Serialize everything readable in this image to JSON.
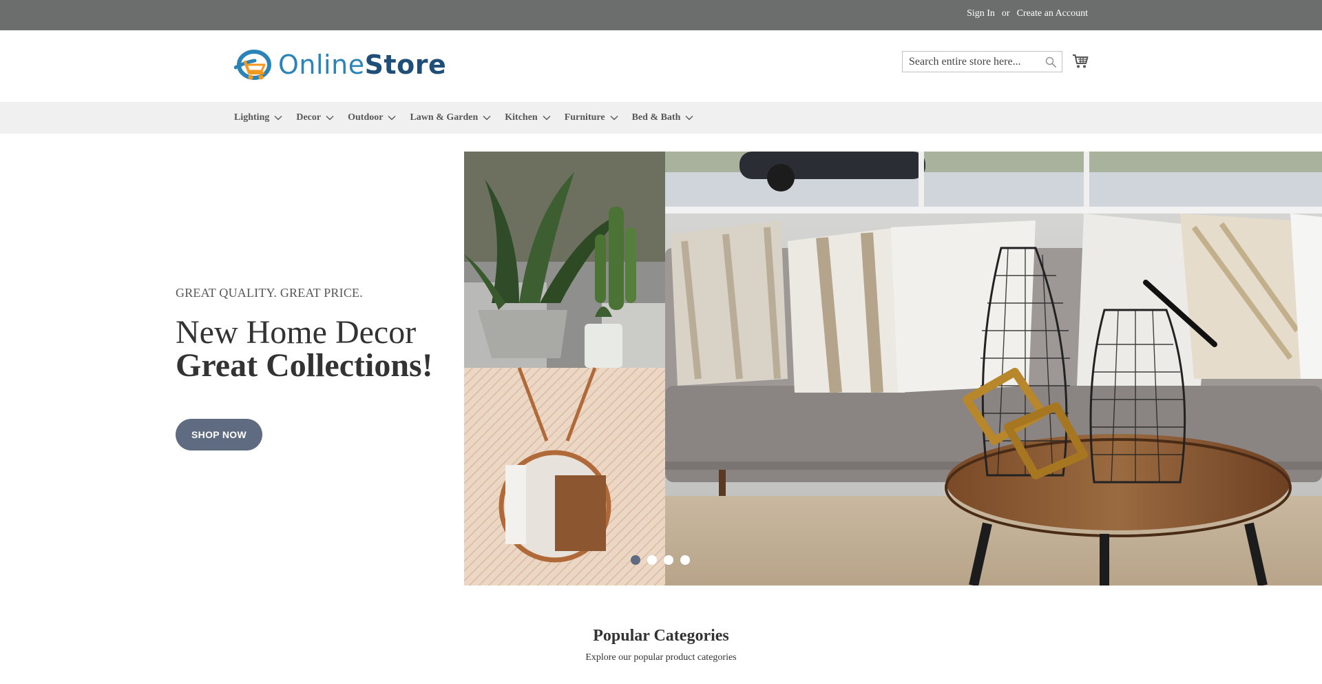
{
  "topbar": {
    "sign_in": "Sign In",
    "separator": "or",
    "create_account": "Create an Account"
  },
  "logo": {
    "part1": "Online",
    "part2": "Store"
  },
  "search": {
    "placeholder": "Search entire store here..."
  },
  "nav": {
    "items": [
      {
        "label": "Lighting"
      },
      {
        "label": "Decor"
      },
      {
        "label": "Outdoor"
      },
      {
        "label": "Lawn & Garden"
      },
      {
        "label": "Kitchen"
      },
      {
        "label": "Furniture"
      },
      {
        "label": "Bed & Bath"
      }
    ]
  },
  "hero": {
    "tagline": "GREAT QUALITY. GREAT PRICE.",
    "headline_line1": "New Home Decor",
    "headline_line2": "Great Collections!",
    "cta_label": "SHOP NOW",
    "slides_total": 4,
    "active_slide": 1
  },
  "popular": {
    "title": "Popular Categories",
    "subtitle": "Explore our popular product categories"
  },
  "colors": {
    "topbar_bg": "#6b6e6d",
    "nav_bg": "#f0f0f0",
    "button_bg": "#5f6b80",
    "logo_blue": "#2b84b8",
    "logo_navy": "#1f4e79",
    "logo_orange": "#f39a1e"
  },
  "icons": {
    "search": "search-icon",
    "cart": "cart-icon",
    "chevron": "chevron-down-icon"
  }
}
